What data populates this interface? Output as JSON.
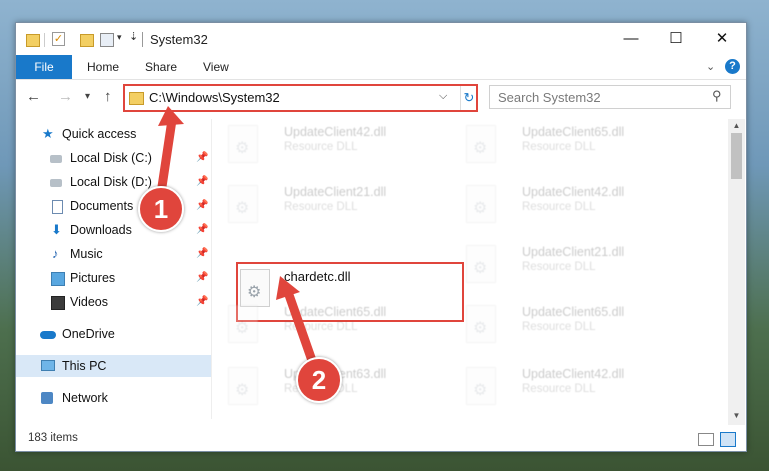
{
  "window": {
    "title": "System32",
    "controls": {
      "minimize": "—",
      "maximize": "☐",
      "close": "✕"
    }
  },
  "ribbon": {
    "tabs": [
      "File",
      "Home",
      "Share",
      "View"
    ]
  },
  "navigation": {
    "address": "C:\\Windows\\System32",
    "search_placeholder": "Search System32"
  },
  "sidebar": {
    "items": [
      {
        "label": "Quick access",
        "icon": "star-icon",
        "pinned": false
      },
      {
        "label": "Local Disk (C:)",
        "icon": "disk-icon",
        "pinned": true
      },
      {
        "label": "Local Disk (D:)",
        "icon": "disk-icon",
        "pinned": true
      },
      {
        "label": "Documents",
        "icon": "documents-icon",
        "pinned": true
      },
      {
        "label": "Downloads",
        "icon": "download-icon",
        "pinned": true
      },
      {
        "label": "Music",
        "icon": "music-icon",
        "pinned": true
      },
      {
        "label": "Pictures",
        "icon": "pictures-icon",
        "pinned": true
      },
      {
        "label": "Videos",
        "icon": "videos-icon",
        "pinned": true
      },
      {
        "label": "OneDrive",
        "icon": "cloud-icon",
        "pinned": false
      },
      {
        "label": "This PC",
        "icon": "computer-icon",
        "pinned": false,
        "selected": true
      },
      {
        "label": "Network",
        "icon": "network-icon",
        "pinned": false
      }
    ]
  },
  "files": {
    "left_column": [
      {
        "name": "UpdateClient42.dll",
        "type": "Resource DLL",
        "faded": true
      },
      {
        "name": "UpdateClient21.dll",
        "type": "Resource DLL",
        "faded": true
      },
      {
        "name": "chardetc.dll",
        "type": "",
        "faded": false,
        "highlighted": true
      },
      {
        "name": "UpdateClient65.dll",
        "type": "Resource DLL",
        "faded": true
      },
      {
        "name": "UpdateClient63.dll",
        "type": "Resource DLL",
        "faded": true
      }
    ],
    "right_column": [
      {
        "name": "UpdateClient65.dll",
        "type": "Resource DLL",
        "faded": true
      },
      {
        "name": "UpdateClient42.dll",
        "type": "Resource DLL",
        "faded": true
      },
      {
        "name": "UpdateClient21.dll",
        "type": "Resource DLL",
        "faded": true
      },
      {
        "name": "UpdateClient65.dll",
        "type": "Resource DLL",
        "faded": true
      },
      {
        "name": "UpdateClient42.dll",
        "type": "Resource DLL",
        "faded": true
      }
    ]
  },
  "status": {
    "items_count": "183 items"
  },
  "annotations": {
    "step1": "1",
    "step2": "2",
    "color": "#e0453c"
  }
}
